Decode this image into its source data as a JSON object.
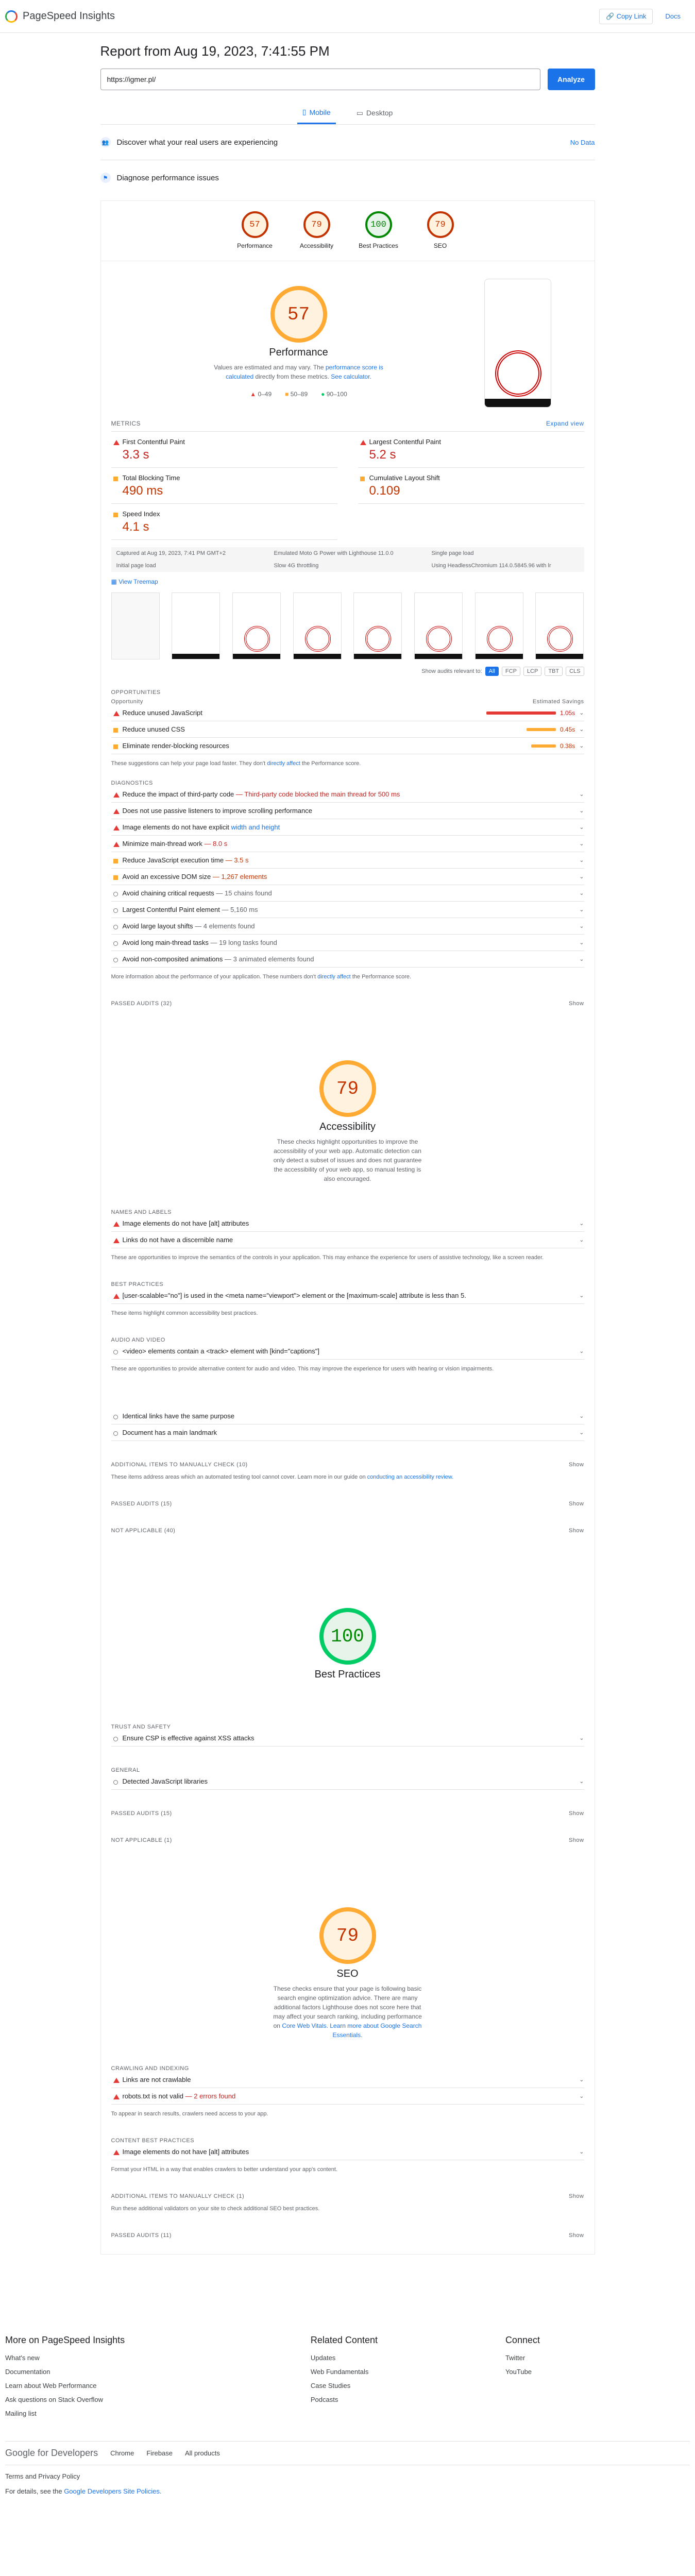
{
  "header": {
    "title": "PageSpeed Insights",
    "copy_link": "Copy Link",
    "docs": "Docs"
  },
  "report": {
    "title": "Report from Aug 19, 2023, 7:41:55 PM",
    "url": "https://igmer.pl/",
    "analyze": "Analyze"
  },
  "tabs": {
    "mobile": "Mobile",
    "desktop": "Desktop"
  },
  "discover": {
    "label": "Discover what your real users are experiencing",
    "no_data": "No Data"
  },
  "diagnose": {
    "label": "Diagnose performance issues"
  },
  "gauges": [
    {
      "score": "57",
      "label": "Performance",
      "color": "#ffaa33"
    },
    {
      "score": "79",
      "label": "Accessibility",
      "color": "#ffaa33"
    },
    {
      "score": "100",
      "label": "Best Practices",
      "color": "#00cc66"
    },
    {
      "score": "79",
      "label": "SEO",
      "color": "#ffaa33"
    }
  ],
  "performance": {
    "score": "57",
    "title": "Performance",
    "desc": "Values are estimated and may vary. The",
    "desc_link": "performance score is calculated",
    "desc2": "directly from these metrics.",
    "calc": "See calculator.",
    "legend": [
      "0–49",
      "50–89",
      "90–100"
    ],
    "metrics_label": "METRICS",
    "expand": "Expand view",
    "metrics": [
      {
        "label": "First Contentful Paint",
        "value": "3.3 s"
      },
      {
        "label": "Largest Contentful Paint",
        "value": "5.2 s"
      },
      {
        "label": "Total Blocking Time",
        "value": "490 ms"
      },
      {
        "label": "Cumulative Layout Shift",
        "value": "0.109"
      },
      {
        "label": "Speed Index",
        "value": "4.1 s"
      }
    ],
    "info": [
      "Captured at Aug 19, 2023, 7:41 PM GMT+2",
      "Emulated Moto G Power with Lighthouse 11.0.0",
      "Single page load",
      "Initial page load",
      "Slow 4G throttling",
      "Using HeadlessChromium 114.0.5845.96 with lr"
    ],
    "view_treemap": "View Treemap",
    "show_audits": "Show audits relevant to:",
    "chips": [
      "All",
      "FCP",
      "LCP",
      "TBT",
      "CLS"
    ]
  },
  "opportunities": {
    "label": "OPPORTUNITIES",
    "col": "Opportunity",
    "col2": "Estimated Savings",
    "items": [
      {
        "label": "Reduce unused JavaScript",
        "saving": "1.05s",
        "sev": "red",
        "pct": 0.9
      },
      {
        "label": "Reduce unused CSS",
        "saving": "0.45s",
        "sev": "orange",
        "pct": 0.38
      },
      {
        "label": "Eliminate render-blocking resources",
        "saving": "0.38s",
        "sev": "orange",
        "pct": 0.32
      }
    ],
    "note": "These suggestions can help your page load faster. They don't",
    "note_link": "directly affect",
    "note2": "the Performance score."
  },
  "diagnostics": {
    "label": "DIAGNOSTICS",
    "items": [
      {
        "label": "Reduce the impact of third-party code",
        "extra": "— Third-party code blocked the main thread for 500 ms",
        "sev": "red"
      },
      {
        "label": "Does not use passive listeners to improve scrolling performance",
        "extra": "",
        "sev": "red"
      },
      {
        "label": "Image elements do not have explicit",
        "extra": "width and height",
        "sev": "red"
      },
      {
        "label": "Minimize main-thread work",
        "extra": "— 8.0 s",
        "sev": "red"
      },
      {
        "label": "Reduce JavaScript execution time",
        "extra": "— 3.5 s",
        "sev": "orange"
      },
      {
        "label": "Avoid an excessive DOM size",
        "extra": "— 1,267 elements",
        "sev": "orange"
      },
      {
        "label": "Avoid chaining critical requests",
        "extra": "— 15 chains found",
        "sev": "gray"
      },
      {
        "label": "Largest Contentful Paint element",
        "extra": "— 5,160 ms",
        "sev": "gray"
      },
      {
        "label": "Avoid large layout shifts",
        "extra": "— 4 elements found",
        "sev": "gray"
      },
      {
        "label": "Avoid long main-thread tasks",
        "extra": "— 19 long tasks found",
        "sev": "gray"
      },
      {
        "label": "Avoid non-composited animations",
        "extra": "— 3 animated elements found",
        "sev": "gray"
      }
    ],
    "note": "More information about the performance of your application. These numbers don't",
    "note_link": "directly affect",
    "note2": "the Performance score.",
    "passed": "PASSED AUDITS (32)",
    "show": "Show"
  },
  "accessibility": {
    "score": "79",
    "title": "Accessibility",
    "desc": "These checks highlight opportunities to improve the accessibility of your web app. Automatic detection can only detect a subset of issues and does not guarantee the accessibility of your web app, so manual testing is also encouraged.",
    "names_label": "NAMES AND LABELS",
    "names": [
      {
        "label": "Image elements do not have [alt] attributes"
      },
      {
        "label": "Links do not have a discernible name"
      }
    ],
    "names_note": "These are opportunities to improve the semantics of the controls in your application. This may enhance the experience for users of assistive technology, like a screen reader.",
    "best_label": "BEST PRACTICES",
    "best": [
      {
        "label": "[user-scalable=\"no\"] is used in the <meta name=\"viewport\"> element or the [maximum-scale] attribute is less than 5."
      }
    ],
    "best_note": "These items highlight common accessibility best practices.",
    "av_label": "AUDIO AND VIDEO",
    "av": [
      {
        "label": "<video> elements contain a <track> element with [kind=\"captions\"]"
      }
    ],
    "av_note": "These are opportunities to provide alternative content for audio and video. This may improve the experience for users with hearing or vision impairments.",
    "extra": [
      {
        "label": "Identical links have the same purpose"
      },
      {
        "label": "Document has a main landmark"
      }
    ],
    "manual": "ADDITIONAL ITEMS TO MANUALLY CHECK (10)",
    "manual_note": "These items address areas which an automated testing tool cannot cover. Learn more in our guide on",
    "manual_link": "conducting an accessibility review.",
    "passed": "PASSED AUDITS (15)",
    "na": "NOT APPLICABLE (40)",
    "show": "Show"
  },
  "best_practices": {
    "score": "100",
    "title": "Best Practices",
    "trust_label": "TRUST AND SAFETY",
    "trust": [
      {
        "label": "Ensure CSP is effective against XSS attacks"
      }
    ],
    "general_label": "GENERAL",
    "general": [
      {
        "label": "Detected JavaScript libraries"
      }
    ],
    "passed": "PASSED AUDITS (15)",
    "na": "NOT APPLICABLE (1)",
    "show": "Show"
  },
  "seo": {
    "score": "79",
    "title": "SEO",
    "desc": "These checks ensure that your page is following basic search engine optimization advice. There are many additional factors Lighthouse does not score here that may affect your search ranking, including performance on",
    "desc_link": "Core Web Vitals. Learn more about Google Search Essentials.",
    "crawl_label": "CRAWLING AND INDEXING",
    "crawl": [
      {
        "label": "Links are not crawlable",
        "extra": ""
      },
      {
        "label": "robots.txt is not valid",
        "extra": "— 2 errors found"
      }
    ],
    "crawl_note": "To appear in search results, crawlers need access to your app.",
    "content_label": "CONTENT BEST PRACTICES",
    "content": [
      {
        "label": "Image elements do not have [alt] attributes"
      }
    ],
    "content_note": "Format your HTML in a way that enables crawlers to better understand your app's content.",
    "manual": "ADDITIONAL ITEMS TO MANUALLY CHECK (1)",
    "manual_note": "Run these additional validators on your site to check additional SEO best practices.",
    "passed": "PASSED AUDITS (11)",
    "show": "Show"
  },
  "footer": {
    "col1_title": "More on PageSpeed Insights",
    "col1": [
      "What's new",
      "Documentation",
      "Learn about Web Performance",
      "Ask questions on Stack Overflow",
      "Mailing list"
    ],
    "col2_title": "Related Content",
    "col2": [
      "Updates",
      "Web Fundamentals",
      "Case Studies",
      "Podcasts"
    ],
    "col3_title": "Connect",
    "col3": [
      "Twitter",
      "YouTube"
    ],
    "gd_logo": "Google for Developers",
    "gd_links": [
      "Chrome",
      "Firebase",
      "All products"
    ],
    "terms": "Terms and Privacy Policy",
    "details": "For details, see the",
    "policies": "Google Developers Site Policies."
  }
}
